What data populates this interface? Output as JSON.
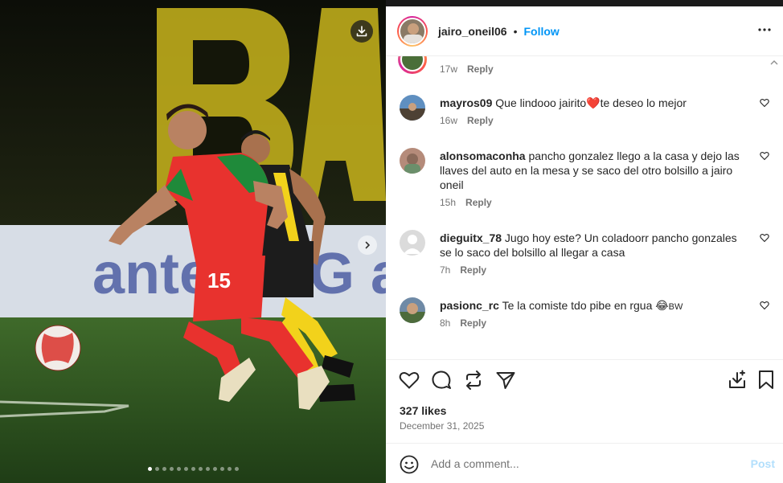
{
  "post": {
    "username": "jairo_oneil06",
    "separator": "•",
    "follow_label": "Follow",
    "more_icon": "more-horizontal-icon",
    "carousel": {
      "total_slides": 13,
      "active_index": 0
    }
  },
  "comments": [
    {
      "username": "",
      "text": "",
      "age": "17w",
      "reply_label": "Reply"
    },
    {
      "username": "mayros09",
      "text": "Que lindooo jairito",
      "emoji": "❤️",
      "text_after": "te deseo lo mejor",
      "age": "16w",
      "reply_label": "Reply"
    },
    {
      "username": "alonsomaconha",
      "text": "pancho gonzalez llego a la casa y dejo las llaves del auto en la mesa y se saco del otro bolsillo a jairo oneil",
      "age": "15h",
      "reply_label": "Reply"
    },
    {
      "username": "dieguitx_78",
      "text": "Jugo hoy este? Un coladoorr pancho gonzales se lo saco del bolsillo al llegar a casa",
      "age": "7h",
      "reply_label": "Reply"
    },
    {
      "username": "pasionc_rc",
      "text": "Te la comiste tdo pibe en rgua",
      "emoji": "😂",
      "text_after": "BW",
      "age": "8h",
      "reply_label": "Reply"
    }
  ],
  "engagement": {
    "likes": "327 likes",
    "date": "December 31, 2025"
  },
  "composer": {
    "placeholder": "Add a comment...",
    "post_label": "Post"
  },
  "colors": {
    "accent": "#0095f6",
    "post_disabled": "#b2dffc",
    "jersey_red": "#e8322e",
    "jersey_green": "#1f8a3a",
    "rival_yellow": "#f2d21b"
  }
}
